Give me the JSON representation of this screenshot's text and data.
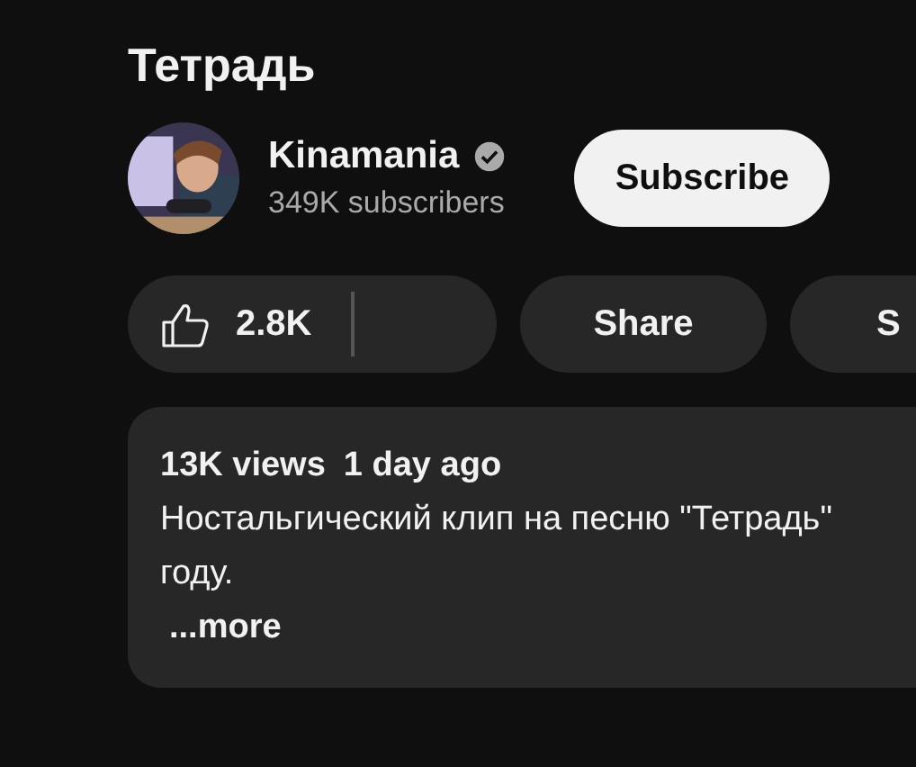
{
  "video_title": "Тетрадь",
  "channel": {
    "name": "Kinamania",
    "verified": true,
    "subscribers": "349K subscribers",
    "subscribe_label": "Subscribe"
  },
  "actions": [
    {
      "kind": "like",
      "label": "2.8K"
    },
    {
      "kind": "share",
      "label": "Share"
    },
    {
      "kind": "plain",
      "label": "S"
    }
  ],
  "description": {
    "views": "13K views",
    "date": "1 day ago",
    "lines": [
      "Ностальгический клип на песню \"Тетрадь\"",
      "году."
    ],
    "more": "...more"
  }
}
